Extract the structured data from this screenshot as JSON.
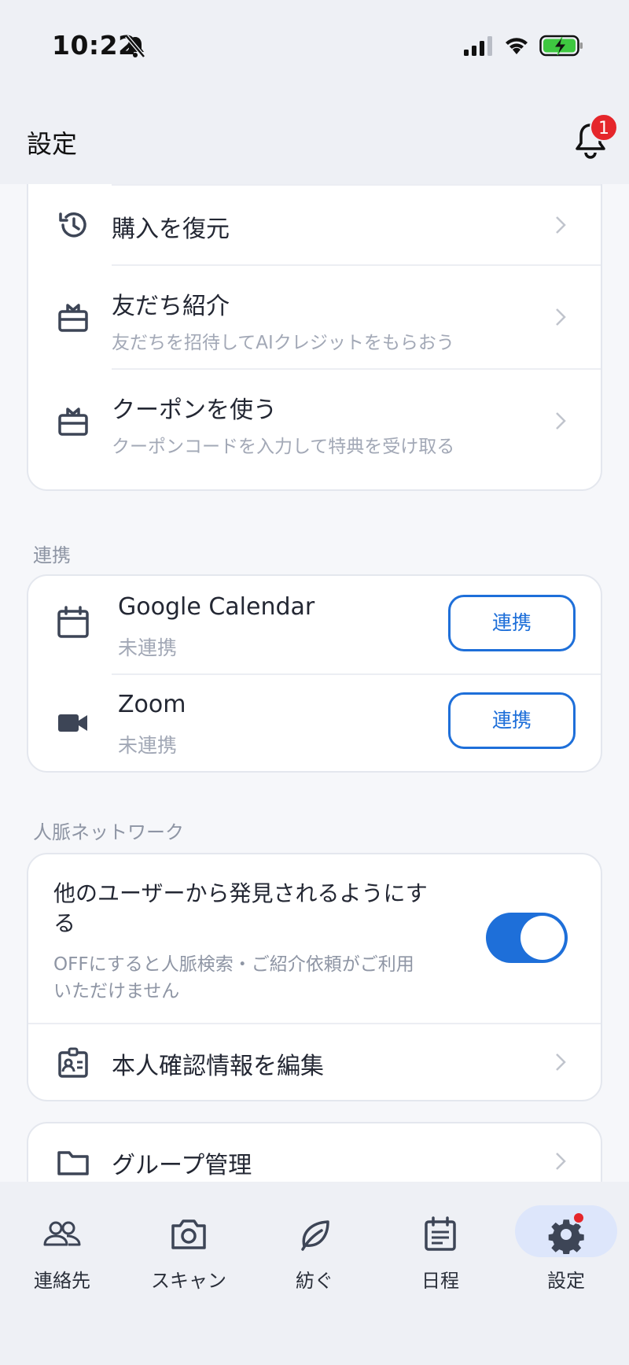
{
  "status": {
    "time": "10:22"
  },
  "header": {
    "title": "設定",
    "badge_count": "1"
  },
  "account_section": {
    "items": [
      {
        "title": "購入を復元",
        "icon": "history-icon"
      },
      {
        "title": "友だち紹介",
        "subtitle": "友だちを招待してAIクレジットをもらおう",
        "icon": "gift-icon"
      },
      {
        "title": "クーポンを使う",
        "subtitle": "クーポンコードを入力して特典を受け取る",
        "icon": "gift-icon"
      }
    ]
  },
  "integrations": {
    "label": "連携",
    "items": [
      {
        "title": "Google Calendar",
        "status": "未連携",
        "button": "連携",
        "icon": "calendar-icon"
      },
      {
        "title": "Zoom",
        "status": "未連携",
        "button": "連携",
        "icon": "video-camera-icon"
      }
    ]
  },
  "network": {
    "label": "人脈ネットワーク",
    "discoverable": {
      "title_line1": "他のユーザーから発見されるようにす",
      "title_line2": "る",
      "desc_line1": "OFFにすると人脈検索・ご紹介依頼がご利用",
      "desc_line2": "いただけません",
      "enabled": true
    },
    "edit_identity": "本人確認情報を編集"
  },
  "group": {
    "title": "グループ管理"
  },
  "tabbar": {
    "tabs": [
      {
        "label": "連絡先",
        "icon": "contacts-icon"
      },
      {
        "label": "スキャン",
        "icon": "camera-icon"
      },
      {
        "label": "紡ぐ",
        "icon": "leaf-icon"
      },
      {
        "label": "日程",
        "icon": "schedule-icon"
      },
      {
        "label": "設定",
        "icon": "gear-icon",
        "active": true
      }
    ]
  }
}
